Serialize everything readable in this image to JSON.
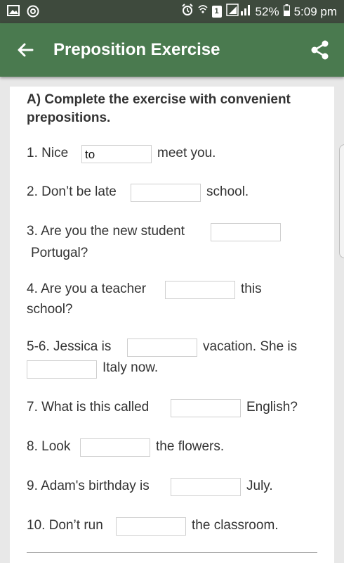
{
  "status_bar": {
    "battery": "52%",
    "time": "5:09 pm",
    "sim_badge": "1",
    "icons": [
      "gallery-icon",
      "sync-icon",
      "alarm-icon",
      "wifi-icon",
      "sim-icon",
      "signal-icon",
      "battery-icon"
    ]
  },
  "app_bar": {
    "title": "Preposition Exercise",
    "back_icon": "arrow-left-icon",
    "share_icon": "share-icon",
    "color": "#4a7a4f"
  },
  "exercise": {
    "heading": "A) Complete the exercise with convenient prepositions.",
    "q1": {
      "before": "1. Nice",
      "answer": "to",
      "after": "meet you."
    },
    "q2": {
      "before": "2. Don’t be late",
      "answer": "",
      "after": "school."
    },
    "q3": {
      "before": "3. Are you the new student",
      "answer": "",
      "after": "Portugal?"
    },
    "q4": {
      "before": "4. Are you a teacher",
      "answer": "",
      "after_a": "this",
      "after_b": "school?"
    },
    "q56": {
      "before": "5-6. Jessica is",
      "answer1": "",
      "after1": "vacation. She is",
      "answer2": "",
      "after2": "Italy now."
    },
    "q7": {
      "before": "7. What is this called",
      "answer": "",
      "after": "English?"
    },
    "q8": {
      "before": "8. Look",
      "answer": "",
      "after": "the flowers."
    },
    "q9": {
      "before": "9. Adam's birthday is",
      "answer": "",
      "after": "July."
    },
    "q10": {
      "before": "10. Don’t run",
      "answer": "",
      "after": "the classroom."
    }
  }
}
